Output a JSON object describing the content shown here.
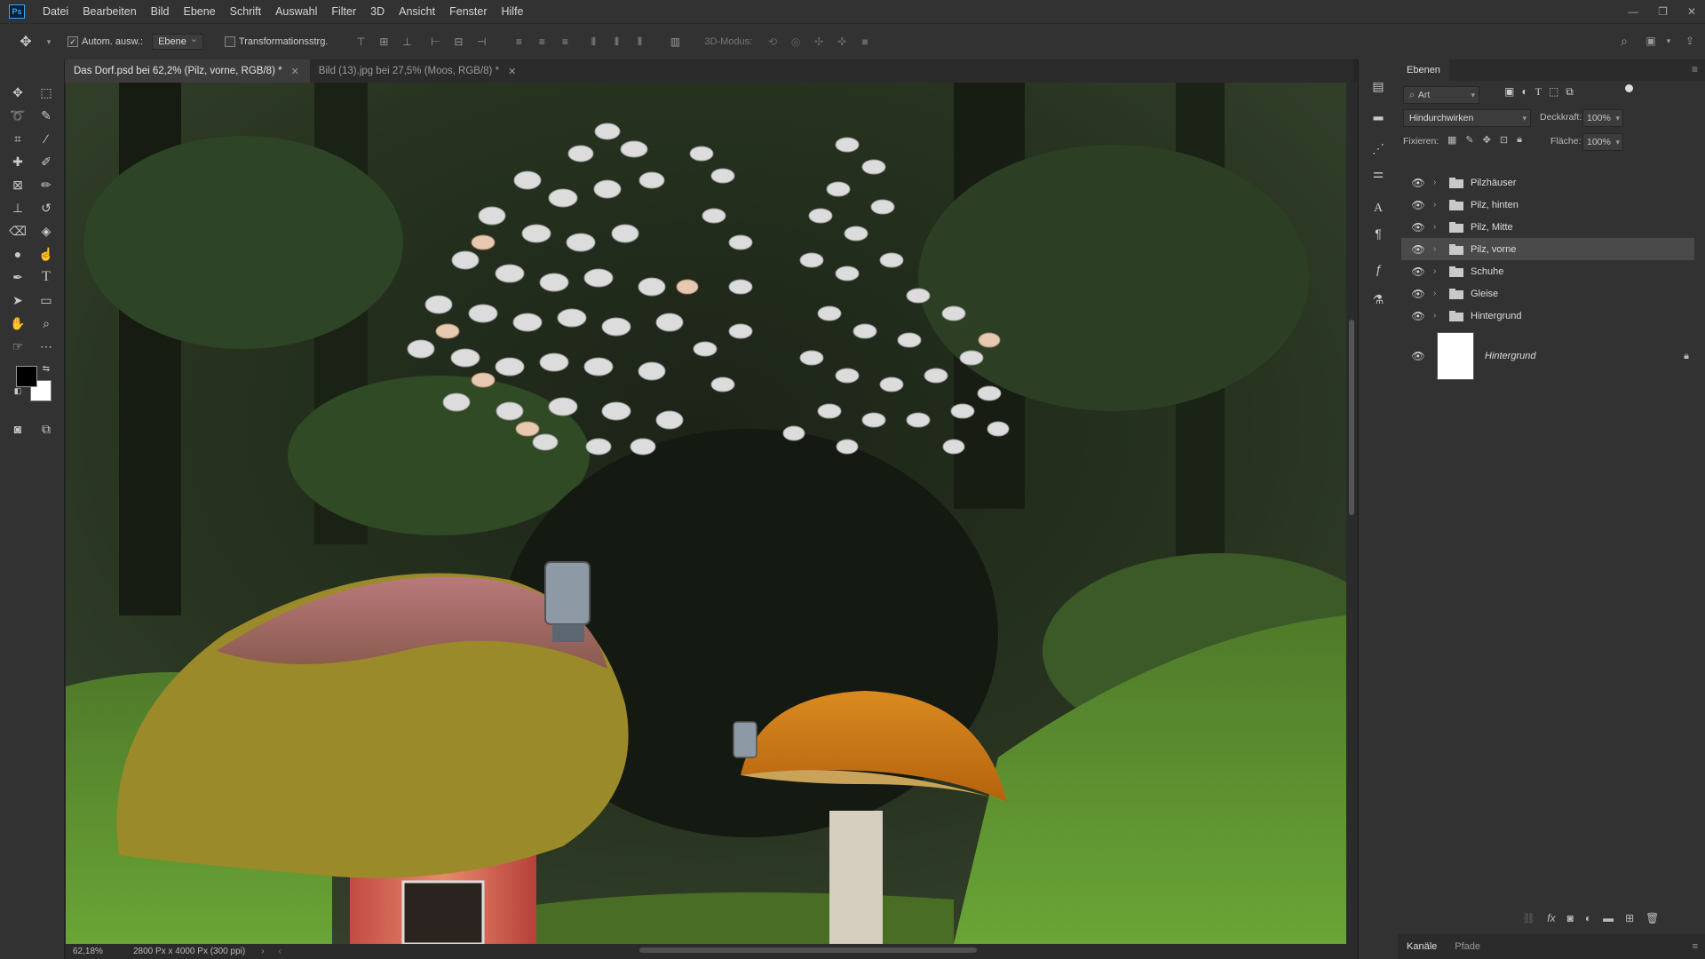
{
  "menubar": {
    "logo": "Ps",
    "items": [
      "Datei",
      "Bearbeiten",
      "Bild",
      "Ebene",
      "Schrift",
      "Auswahl",
      "Filter",
      "3D",
      "Ansicht",
      "Fenster",
      "Hilfe"
    ]
  },
  "options": {
    "auto_select_label": "Autom. ausw.:",
    "auto_select_value": "Ebene",
    "transform_label": "Transformationsstrg.",
    "mode_3d_label": "3D-Modus:"
  },
  "tabs": [
    {
      "label": "Das Dorf.psd bei 62,2% (Pilz, vorne, RGB/8) *",
      "active": true
    },
    {
      "label": "Bild (13).jpg bei 27,5% (Moos, RGB/8) *",
      "active": false
    }
  ],
  "status": {
    "zoom": "62,18%",
    "doc_info": "2800 Px x 4000 Px (300 ppi)"
  },
  "layers_panel": {
    "tab": "Ebenen",
    "filter_kind": "Art",
    "blend_mode": "Hindurchwirken",
    "opacity_label": "Deckkraft:",
    "opacity_value": "100%",
    "lock_label": "Fixieren:",
    "fill_label": "Fläche:",
    "fill_value": "100%",
    "layers": [
      {
        "name": "Pilzhäuser",
        "type": "group",
        "visible": true,
        "selected": false
      },
      {
        "name": "Pilz, hinten",
        "type": "group",
        "visible": true,
        "selected": false
      },
      {
        "name": "Pilz, Mitte",
        "type": "group",
        "visible": true,
        "selected": false
      },
      {
        "name": "Pilz, vorne",
        "type": "group",
        "visible": true,
        "selected": true
      },
      {
        "name": "Schuhe",
        "type": "group",
        "visible": true,
        "selected": false
      },
      {
        "name": "Gleise",
        "type": "group",
        "visible": true,
        "selected": false
      },
      {
        "name": "Hintergrund",
        "type": "group",
        "visible": true,
        "selected": false
      }
    ],
    "background_layer": {
      "name": "Hintergrund",
      "locked": true
    }
  },
  "bottom_tabs": [
    "Kanäle",
    "Pfade"
  ],
  "colors": {
    "ui_dark": "#262626",
    "ui_panel": "#323232",
    "selection": "#4a4a4a",
    "accent": "#31a8ff",
    "foreground_swatch": "#000000",
    "background_swatch": "#ffffff"
  }
}
